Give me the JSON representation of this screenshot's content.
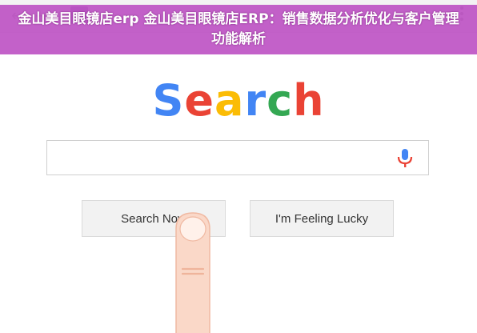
{
  "banner": {
    "title": "金山美目眼镜店erp 金山美目眼镜店ERP：销售数据分析优化与客户管理功能解析"
  },
  "browser": {
    "back_icon": "arrow-left-icon",
    "forward_icon": "arrow-right-icon",
    "menu_icon": "kebab-menu-icon"
  },
  "logo": {
    "letters": [
      {
        "char": "S",
        "color": "#4285F4"
      },
      {
        "char": "e",
        "color": "#EA4335"
      },
      {
        "char": "a",
        "color": "#FBBC05"
      },
      {
        "char": "r",
        "color": "#4285F4"
      },
      {
        "char": "c",
        "color": "#34A853"
      },
      {
        "char": "h",
        "color": "#EA4335"
      }
    ]
  },
  "search": {
    "value": "",
    "mic_icon": "microphone-icon"
  },
  "buttons": {
    "search_now": "Search Now",
    "feeling_lucky": "I'm Feeling Lucky"
  },
  "illustration": {
    "finger_icon": "pointing-finger-icon",
    "skin_color": "#FAD8C8"
  }
}
